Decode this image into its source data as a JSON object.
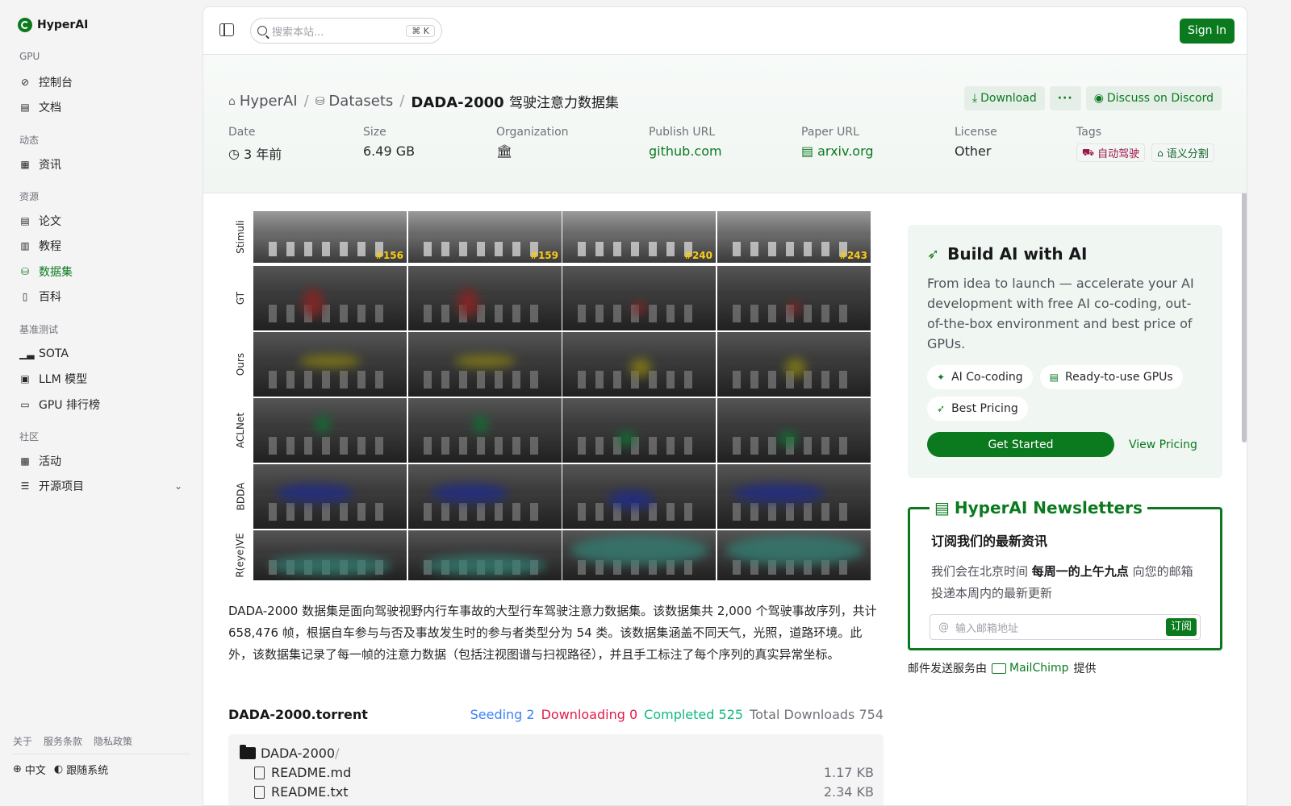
{
  "brand": "HyperAI",
  "sidebar": {
    "sections": [
      {
        "title": "GPU",
        "items": [
          {
            "label": "控制台",
            "icon": "dashboard-icon"
          },
          {
            "label": "文档",
            "icon": "doc-icon"
          }
        ]
      },
      {
        "title": "动态",
        "items": [
          {
            "label": "资讯",
            "icon": "news-icon"
          }
        ]
      },
      {
        "title": "资源",
        "items": [
          {
            "label": "论文",
            "icon": "paper-icon"
          },
          {
            "label": "教程",
            "icon": "tutorial-icon"
          },
          {
            "label": "数据集",
            "icon": "database-icon",
            "active": true
          },
          {
            "label": "百科",
            "icon": "wiki-icon"
          }
        ]
      },
      {
        "title": "基准测试",
        "items": [
          {
            "label": "SOTA",
            "icon": "chart-icon"
          },
          {
            "label": "LLM 模型",
            "icon": "chip-icon"
          },
          {
            "label": "GPU 排行榜",
            "icon": "monitor-icon"
          }
        ]
      },
      {
        "title": "社区",
        "items": [
          {
            "label": "活动",
            "icon": "event-icon"
          },
          {
            "label": "开源项目",
            "icon": "list-icon",
            "expandable": true
          }
        ]
      }
    ],
    "footer_links": [
      "关于",
      "服务条款",
      "隐私政策"
    ],
    "language": "中文",
    "theme": "跟随系统"
  },
  "topbar": {
    "search_placeholder": "搜索本站...",
    "search_shortcut": "⌘ K",
    "signin": "Sign In"
  },
  "breadcrumb": {
    "home": "HyperAI",
    "datasets": "Datasets",
    "current_bold": "DADA-2000",
    "current_rest": "驾驶注意力数据集"
  },
  "actions": {
    "download": "Download",
    "more": "···",
    "discord": "Discuss on Discord"
  },
  "meta": {
    "date_label": "Date",
    "date_value": "3 年前",
    "size_label": "Size",
    "size_value": "6.49 GB",
    "org_label": "Organization",
    "publish_label": "Publish URL",
    "publish_value": "github.com",
    "paper_label": "Paper URL",
    "paper_value": "arxiv.org",
    "license_label": "License",
    "license_value": "Other",
    "tags_label": "Tags",
    "tags": [
      "自动驾驶",
      "语义分割"
    ]
  },
  "figure": {
    "rows": [
      "Stimuli",
      "GT",
      "Ours",
      "ACLNet",
      "BDDA",
      "R(eye)VE"
    ],
    "frames": [
      "#156",
      "#159",
      "#240",
      "#243"
    ]
  },
  "description": "DADA-2000 数据集是面向驾驶视野内行车事故的大型行车驾驶注意力数据集。该数据集共 2,000 个驾驶事故序列，共计 658,476 帧，根据自车参与与否及事故发生时的参与者类型分为 54 类。该数据集涵盖不同天气，光照，道路环境。此外，该数据集记录了每一帧的注意力数据（包括注视图谱与扫视路径），并且手工标注了每个序列的真实异常坐标。",
  "torrent": {
    "title": "DADA-2000.torrent",
    "seeding": "Seeding 2",
    "downloading": "Downloading 0",
    "completed": "Completed 525",
    "total": "Total Downloads 754",
    "folder": "DADA-2000",
    "files": [
      {
        "name": "README.md",
        "size": "1.17 KB"
      },
      {
        "name": "README.txt",
        "size": "2.34 KB"
      }
    ]
  },
  "promo": {
    "title": "Build AI with AI",
    "text": "From idea to launch — accelerate your AI development with free AI co-coding, out-of-the-box environment and best price of GPUs.",
    "pills": [
      "AI Co-coding",
      "Ready-to-use GPUs",
      "Best Pricing"
    ],
    "cta": "Get Started",
    "pricing": "View Pricing"
  },
  "newsletter": {
    "title": "HyperAI Newsletters",
    "subtitle": "订阅我们的最新资讯",
    "text_pre": "我们会在北京时间",
    "text_bold": "每周一的上午九点",
    "text_post": "向您的邮箱投递本周内的最新更新",
    "placeholder": "输入邮箱地址",
    "submit": "订阅",
    "credit_pre": "邮件发送服务由",
    "credit_brand": "MailChimp",
    "credit_post": "提供"
  }
}
